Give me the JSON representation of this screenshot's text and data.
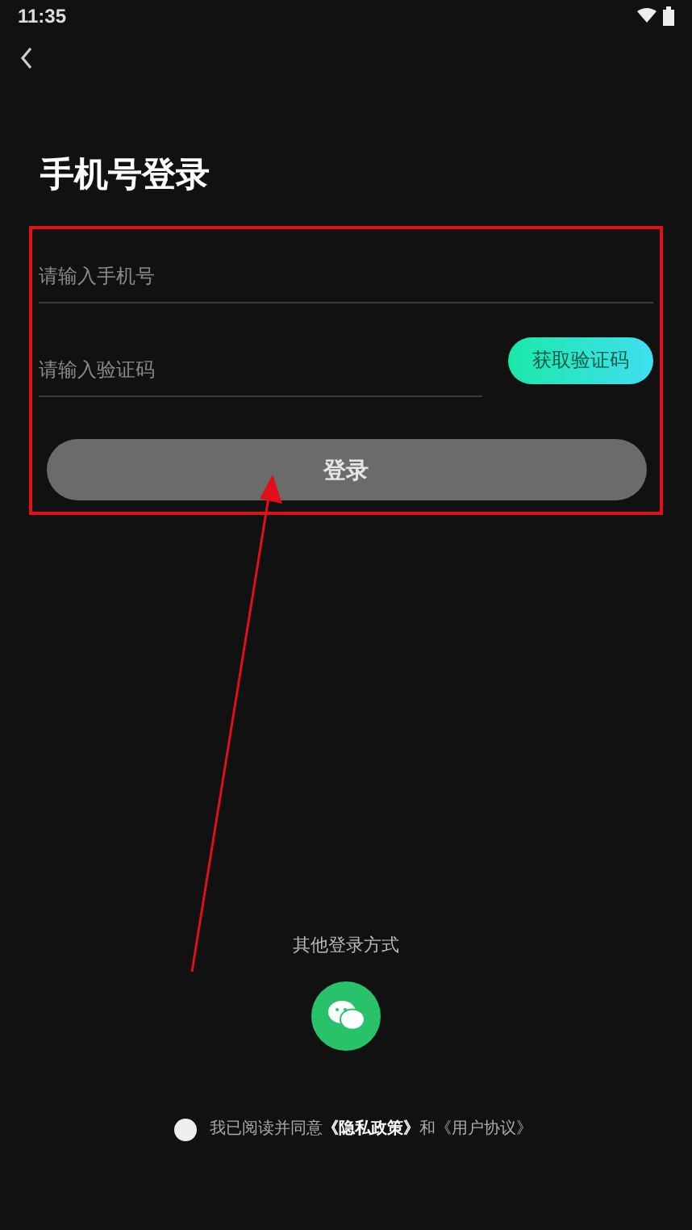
{
  "status_bar": {
    "time": "11:35"
  },
  "title": "手机号登录",
  "phone_field": {
    "placeholder": "请输入手机号"
  },
  "code_field": {
    "placeholder": "请输入验证码"
  },
  "get_code_button": "获取验证码",
  "login_button": {
    "label": "登录",
    "disabled": true
  },
  "other_login": {
    "label": "其他登录方式"
  },
  "agreement": {
    "checked": false,
    "text": "我已阅读并同意",
    "privacy_link": "《隐私政策》",
    "and": "和",
    "terms_link": "《用户协议》"
  }
}
